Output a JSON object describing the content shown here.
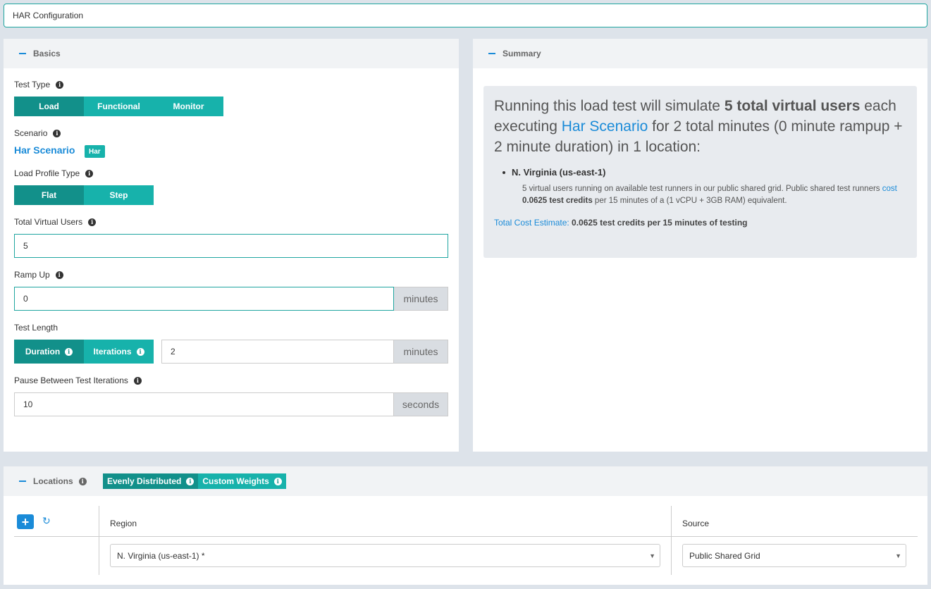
{
  "config_name": "HAR Configuration",
  "basics": {
    "title": "Basics",
    "test_type_label": "Test Type",
    "test_types": [
      "Load",
      "Functional",
      "Monitor"
    ],
    "scenario_label": "Scenario",
    "scenario_link": "Har Scenario",
    "scenario_badge": "Har",
    "load_profile_label": "Load Profile Type",
    "load_profiles": [
      "Flat",
      "Step"
    ],
    "total_vu_label": "Total Virtual Users",
    "total_vu_value": "5",
    "ramp_up_label": "Ramp Up",
    "ramp_up_value": "0",
    "ramp_up_unit": "minutes",
    "test_length_label": "Test Length",
    "test_length_modes": [
      "Duration",
      "Iterations"
    ],
    "test_length_value": "2",
    "test_length_unit": "minutes",
    "pause_label": "Pause Between Test Iterations",
    "pause_value": "10",
    "pause_unit": "seconds"
  },
  "summary": {
    "title": "Summary",
    "line_pre": "Running this load test will simulate ",
    "line_bold": "5 total virtual users",
    "line_mid": " each executing ",
    "line_link": "Har Scenario",
    "line_post": " for 2 total minutes (0 minute rampup + 2 minute duration) in 1 location:",
    "location_name": "N. Virginia (us-east-1)",
    "location_desc_pre": "5 virtual users running on available test runners in our public shared grid. Public shared test runners ",
    "location_desc_link": "cost",
    "location_desc_bold": " 0.0625 test credits",
    "location_desc_post": " per 15 minutes of a (1 vCPU + 3GB RAM) equivalent.",
    "total_cost_label": "Total Cost Estimate:",
    "total_cost_value": " 0.0625 ",
    "total_cost_link": "test credits",
    "total_cost_post": " per 15 minutes of testing"
  },
  "locations": {
    "title": "Locations",
    "distribution_modes": [
      "Evenly Distributed",
      "Custom Weights"
    ],
    "columns": {
      "region": "Region",
      "source": "Source"
    },
    "rows": [
      {
        "region": "N. Virginia (us-east-1) *",
        "source": "Public Shared Grid"
      }
    ]
  },
  "colors": {
    "teal": "#17b2ab",
    "teal_dark": "#12908a",
    "link_blue": "#1a8bd8"
  }
}
